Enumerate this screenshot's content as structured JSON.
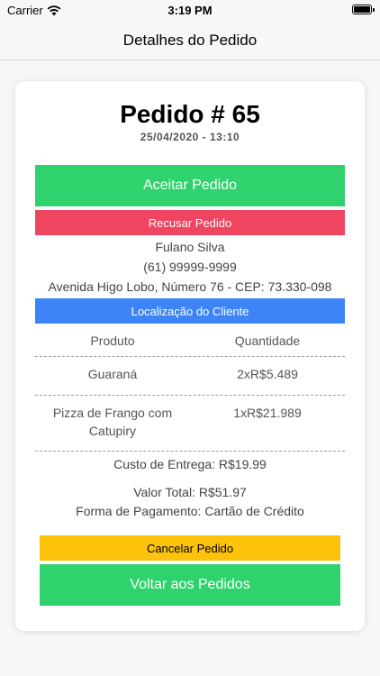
{
  "status_bar": {
    "carrier": "Carrier",
    "time": "3:19 PM"
  },
  "nav": {
    "title": "Detalhes do Pedido"
  },
  "order": {
    "title": "Pedido # 65",
    "datetime": "25/04/2020 - 13:10"
  },
  "actions": {
    "accept_label": "Aceitar Pedido",
    "refuse_label": "Recusar Pedido",
    "location_label": "Localização do Cliente",
    "cancel_label": "Cancelar Pedido",
    "back_label": "Voltar aos Pedidos"
  },
  "customer": {
    "name": "Fulano Silva",
    "phone": "(61) 99999-9999",
    "address": "Avenida Higo Lobo, Número 76 - CEP: 73.330-098"
  },
  "items_table": {
    "headers": [
      "Produto",
      "Quantidade"
    ],
    "rows": [
      {
        "product": "Guaraná",
        "quantity": "2xR$5.489"
      },
      {
        "product": "Pizza de Frango com Catupiry",
        "quantity": "1xR$21.989"
      }
    ]
  },
  "summary": {
    "delivery": "Custo de Entrega: R$19.99",
    "total": "Valor Total: R$51.97",
    "payment": "Forma de Pagamento: Cartão de Crédito"
  },
  "colors": {
    "accept": "#2fd26d",
    "refuse": "#ef4560",
    "location": "#3d85f6",
    "cancel": "#fcc20c"
  }
}
